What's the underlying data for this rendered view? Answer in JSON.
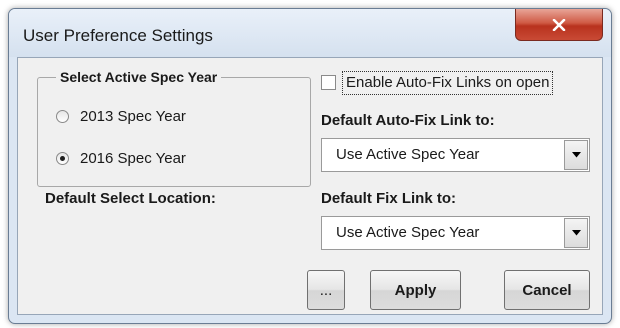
{
  "window": {
    "title": "User Preference Settings"
  },
  "spec_year_group": {
    "legend": "Select Active Spec Year",
    "options": [
      {
        "label": "2013 Spec Year",
        "checked": false
      },
      {
        "label": "2016 Spec Year",
        "checked": true
      }
    ]
  },
  "auto_fix_checkbox": {
    "label": "Enable Auto-Fix Links on open",
    "checked": false
  },
  "default_auto_fix": {
    "label": "Default Auto-Fix Link to:",
    "value": "Use Active Spec Year"
  },
  "default_fix": {
    "label": "Default Fix Link to:",
    "value": "Use Active Spec Year"
  },
  "default_select_location": {
    "label": "Default Select Location:"
  },
  "buttons": {
    "browse": "...",
    "apply": "Apply",
    "cancel": "Cancel"
  },
  "icons": {
    "close": "close-x-icon",
    "dropdown": "chevron-down-icon"
  },
  "colors": {
    "close_button": "#c94a35",
    "frame": "#dbe6f3",
    "client": "#f0f0f0"
  }
}
